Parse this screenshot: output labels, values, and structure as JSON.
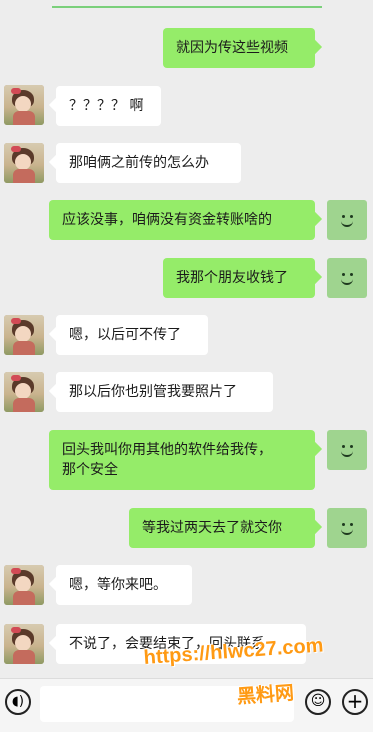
{
  "messages": [
    {
      "side": "right",
      "text": "就因为传这些视频"
    },
    {
      "side": "left",
      "text": "？？？？ 啊"
    },
    {
      "side": "left",
      "text": "那咱俩之前传的怎么办"
    },
    {
      "side": "right",
      "text": "应该没事，咱俩没有资金转账啥的"
    },
    {
      "side": "right",
      "text": "我那个朋友收钱了"
    },
    {
      "side": "left",
      "text": "嗯，以后可不传了"
    },
    {
      "side": "left",
      "text": "那以后你也别管我要照片了"
    },
    {
      "side": "right",
      "lines": [
        "回头我叫你用其他的软件给我传，",
        "那个安全"
      ]
    },
    {
      "side": "right",
      "text": "等我过两天去了就交你"
    },
    {
      "side": "left",
      "text": "嗯，等你来吧。"
    },
    {
      "side": "left",
      "text": "不说了，会要结束了，回头联系"
    }
  ],
  "input_bar": {
    "voice_icon": "voice-icon",
    "emoji_icon": "emoji-icon",
    "plus_icon": "plus-icon"
  },
  "watermark": {
    "url": "https://hlwc27.com",
    "name": "黑料网"
  },
  "colors": {
    "background": "#ededed",
    "my_bubble": "#95ec69",
    "their_bubble": "#ffffff",
    "watermark": "#ff9a14"
  }
}
